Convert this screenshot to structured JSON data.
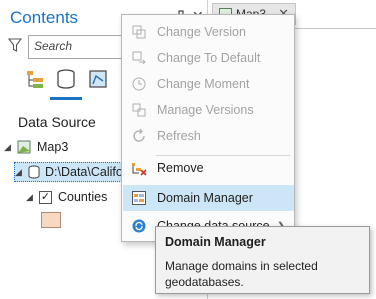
{
  "contents_pane": {
    "title": "Contents",
    "search_placeholder": "Search",
    "section_label": "Data Source",
    "tree": {
      "map_name": "Map3",
      "datasource_path": "D:\\Data\\Califo",
      "layer_name": "Counties",
      "layer_checked": true,
      "swatch_color": "#f6d8c3"
    }
  },
  "map_tab": {
    "label": "Map3"
  },
  "context_menu": {
    "items": [
      {
        "label": "Change Version",
        "enabled": false,
        "icon": "change-version-icon"
      },
      {
        "label": "Change To Default",
        "enabled": false,
        "icon": "change-to-default-icon"
      },
      {
        "label": "Change Moment",
        "enabled": false,
        "icon": "change-moment-icon"
      },
      {
        "label": "Manage Versions",
        "enabled": false,
        "icon": "manage-versions-icon"
      },
      {
        "label": "Refresh",
        "enabled": false,
        "icon": "refresh-icon"
      },
      {
        "label": "Remove",
        "enabled": true,
        "icon": "remove-icon"
      },
      {
        "label": "Domain Manager",
        "enabled": true,
        "icon": "domain-manager-icon",
        "highlighted": true
      },
      {
        "label": "Change data source",
        "enabled": true,
        "icon": "change-data-source-icon",
        "has_submenu": true
      }
    ]
  },
  "tooltip": {
    "title": "Domain Manager",
    "body": "Manage domains in selected geodatabases."
  },
  "colors": {
    "accent": "#1a73c7",
    "highlight": "#cde6f7"
  }
}
